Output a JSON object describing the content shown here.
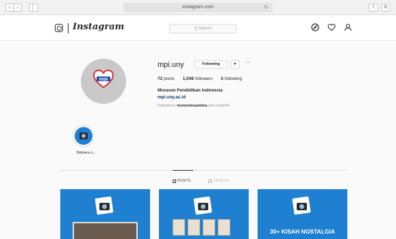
{
  "browser": {
    "url": "instagram.com",
    "back_glyph": "‹",
    "forward_glyph": "›",
    "reload_glyph": "↻",
    "share_glyph": "⇧",
    "tabs_glyph": "⧉"
  },
  "header": {
    "logo_text": "Instagram",
    "search_placeholder": "Q Search"
  },
  "profile": {
    "username": "mpi.uny",
    "follow_label": "Following",
    "dropdown_glyph": "▾",
    "more_glyph": "···",
    "posts_count": "72",
    "posts_label": "posts",
    "followers_count": "1,048",
    "followers_label": "followers",
    "following_count": "5",
    "following_label": "following",
    "full_name": "Museum Pendidikan Indonesia",
    "website": "mpi.uny.ac.id",
    "followed_by_prefix": "Followed by",
    "followed_by_user": "museumnusantara",
    "followed_by_suffix": "and comminfo",
    "avatar_text": "mpi",
    "colors": {
      "avatar_bg": "#c9c9c9",
      "heart_red": "#d62b3a",
      "heart_blue": "#1f4fa0"
    }
  },
  "highlights": [
    {
      "label": "Bidmenu s..."
    }
  ],
  "tabs": [
    {
      "label": "POSTS",
      "active": true
    },
    {
      "label": "TAGGED",
      "active": false
    }
  ],
  "posts": [
    {
      "title": ""
    },
    {
      "title": ""
    },
    {
      "title": "30+ KISAH NOSTALGIA"
    }
  ],
  "colors": {
    "post_blue": "#1f7fd0",
    "link_blue": "#003569"
  }
}
